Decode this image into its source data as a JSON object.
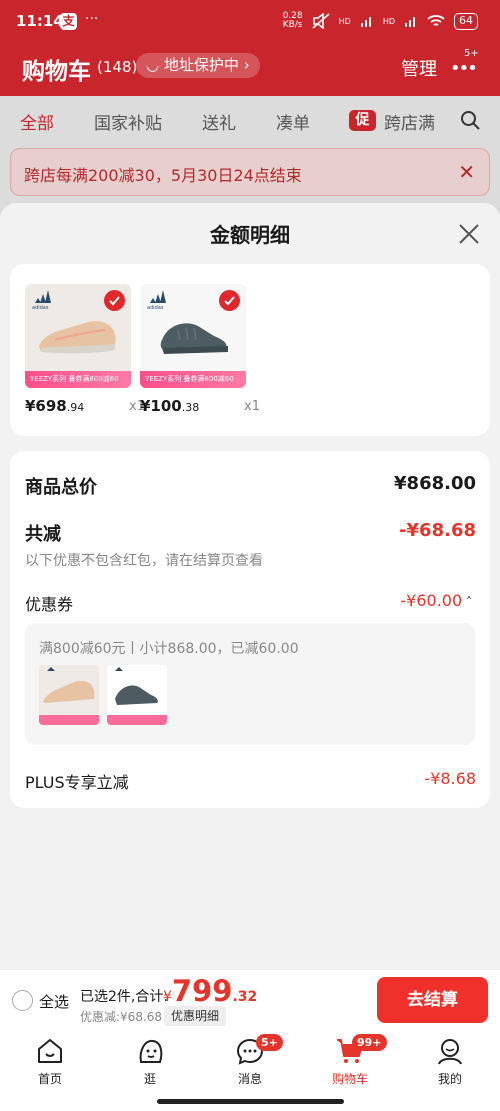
{
  "status_bar": {
    "time": "11:14",
    "alipay_glyph": "支",
    "more": "···",
    "net_speed_value": "0.28",
    "net_speed_unit": "KB/s",
    "signal1": "HD",
    "signal2": "HD",
    "battery": "64"
  },
  "header": {
    "title": "购物车",
    "count": "(148)",
    "address_pill": "地址保护中",
    "manage": "管理",
    "more_badge": "5+"
  },
  "tabs": [
    {
      "label": "全部"
    },
    {
      "label": "国家补贴"
    },
    {
      "label": "送礼"
    },
    {
      "label": "凑单"
    },
    {
      "label": "跨店满"
    }
  ],
  "tab_promo_glyph": "促",
  "notice": {
    "text": "跨店每满200减30，5月30日24点结束"
  },
  "sheet": {
    "title": "金额明细",
    "products": [
      {
        "brand": "adidas",
        "promo": "YEEZY系列 叠券满800减60",
        "price_int": "¥698",
        "price_dec": ".94",
        "qty": "x1"
      },
      {
        "brand": "adidas",
        "promo": "YEEZY系列 叠券满800减60",
        "price_int": "¥100",
        "price_dec": ".38",
        "qty": "x1"
      }
    ],
    "total_label": "商品总价",
    "total_value": "¥868.00",
    "discount_label": "共减",
    "discount_value": "-¥68.68",
    "discount_hint": "以下优惠不包含红包，请在结算页查看",
    "coupon_label": "优惠券",
    "coupon_value": "-¥60.00",
    "coupon_detail": "满800减60元丨小计868.00，已减60.00",
    "plus_label": "PLUS专享立减",
    "plus_value": "-¥8.68"
  },
  "checkout": {
    "select_all": "全选",
    "selected": "已选2件,合计:",
    "currency": "¥",
    "total_int": "799",
    "total_dec": ".32",
    "discount": "优惠减:¥68.68",
    "detail_chip": "优惠明细",
    "pay_button": "去结算"
  },
  "tabbar": [
    {
      "label": "首页"
    },
    {
      "label": "逛"
    },
    {
      "label": "消息",
      "badge": "5+"
    },
    {
      "label": "购物车",
      "badge": "99+"
    },
    {
      "label": "我的"
    }
  ],
  "colors": {
    "brand_red": "#c8262c",
    "price_red": "#e5352b",
    "pay_button": "#f0312b"
  }
}
